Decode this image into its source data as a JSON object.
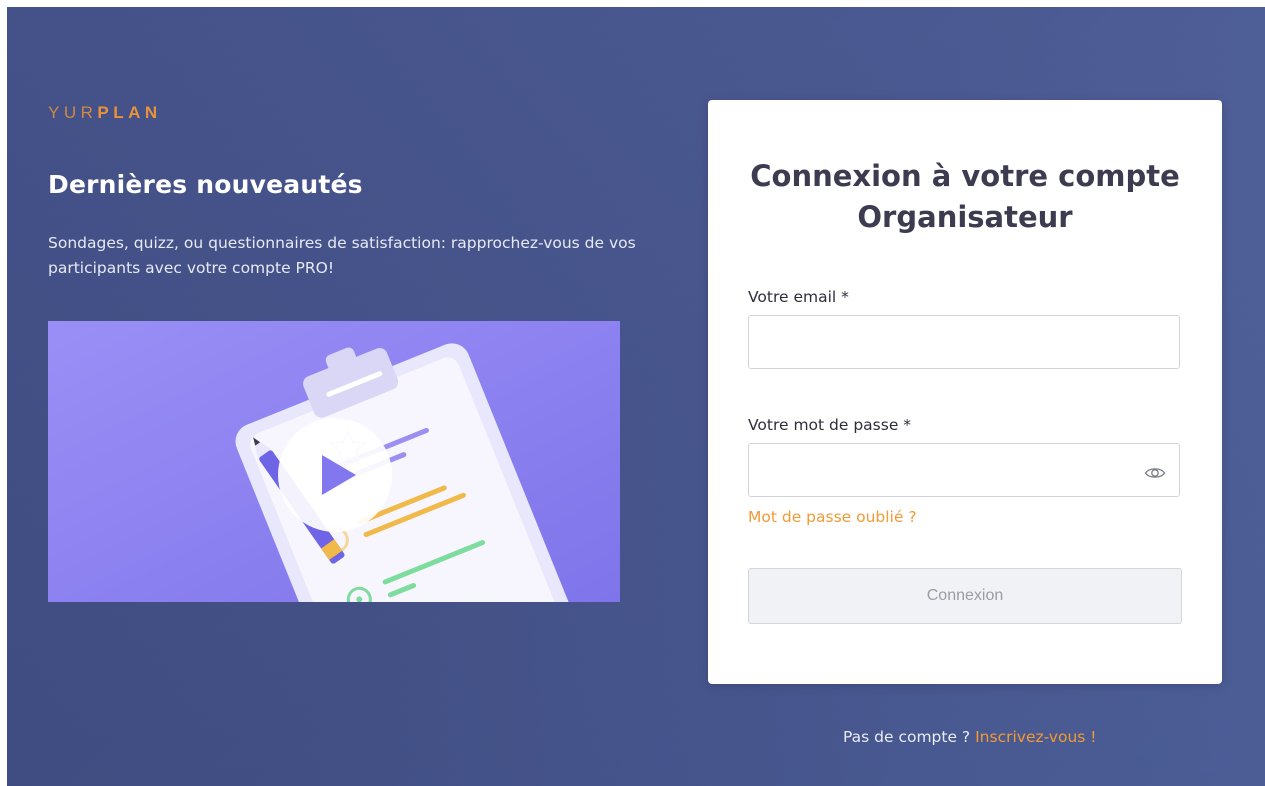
{
  "brand": {
    "logo_part1": "YUR",
    "logo_part2": "PLAN",
    "color": "#e8923a"
  },
  "news": {
    "title": "Dernières nouveautés",
    "description": "Sondages, quizz, ou questionnaires de satisfaction: rapprochez-vous de vos participants avec votre compte PRO!",
    "video": {
      "icon": "play-icon",
      "background_color": "#8e83f3"
    }
  },
  "login": {
    "title": "Connexion à votre compte Organisateur",
    "email_label": "Votre email *",
    "email_value": "",
    "password_label": "Votre mot de passe *",
    "password_value": "",
    "show_password_icon": "eye-icon",
    "forgot_password": "Mot de passe oublié ?",
    "submit_label": "Connexion"
  },
  "signup": {
    "prompt": "Pas de compte ? ",
    "link": "Inscrivez-vous !"
  },
  "colors": {
    "accent": "#f29a35",
    "background": "#46558f",
    "card": "#ffffff"
  }
}
